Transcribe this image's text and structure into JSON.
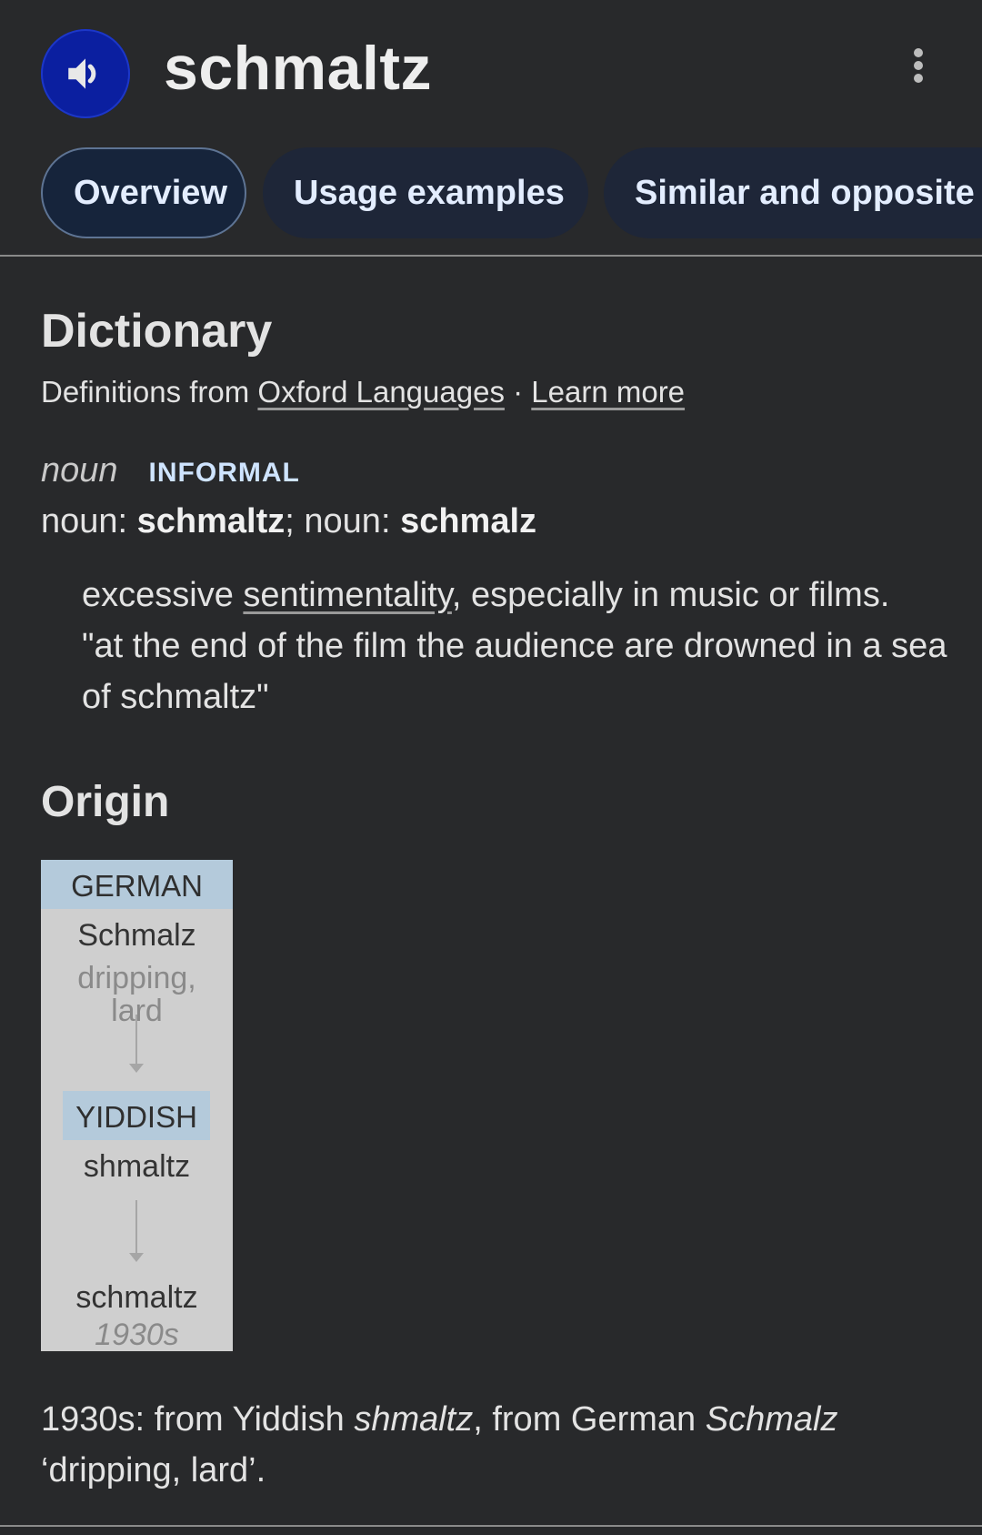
{
  "header": {
    "word": "schmaltz",
    "speaker_icon": "speaker-volume-icon",
    "more_icon": "more-vert-icon"
  },
  "tabs": [
    {
      "label": "Overview",
      "active": true
    },
    {
      "label": "Usage examples",
      "active": false
    },
    {
      "label": "Similar and opposite w",
      "active": false
    }
  ],
  "dictionary": {
    "title": "Dictionary",
    "source_prefix": "Definitions from ",
    "source_link": "Oxford Languages",
    "separator": " · ",
    "learn_more": "Learn more",
    "pos": "noun",
    "register": "INFORMAL",
    "forms": {
      "label1": "noun: ",
      "form1": "schmaltz",
      "sep": "; ",
      "label2": "noun: ",
      "form2": "schmalz"
    },
    "definition": {
      "before": "excessive ",
      "link": "sentimentality",
      "after": ", especially in music or films.",
      "example": "\"at the end of the film the audience are drowned in a sea of schmaltz\""
    }
  },
  "origin": {
    "title": "Origin",
    "diagram": {
      "lang1": "GERMAN",
      "word1": "Schmalz",
      "gloss1a": "dripping,",
      "gloss1b": "lard",
      "lang2": "YIDDISH",
      "word2": "shmaltz",
      "word3": "schmaltz",
      "date3": "1930s"
    },
    "text": {
      "p1": "1930s: from Yiddish ",
      "i1": "shmaltz",
      "p2": ", from German ",
      "i2": "Schmalz",
      "p3": " ‘dripping, lard’."
    }
  },
  "colors": {
    "background": "#28292b",
    "speaker_button": "#0b1fa0",
    "tab_background": "#1e2638",
    "register_label": "#cfe4ff",
    "etymology_panel": "#cfcfcf",
    "etymology_lang_bg": "#b4cadb"
  }
}
